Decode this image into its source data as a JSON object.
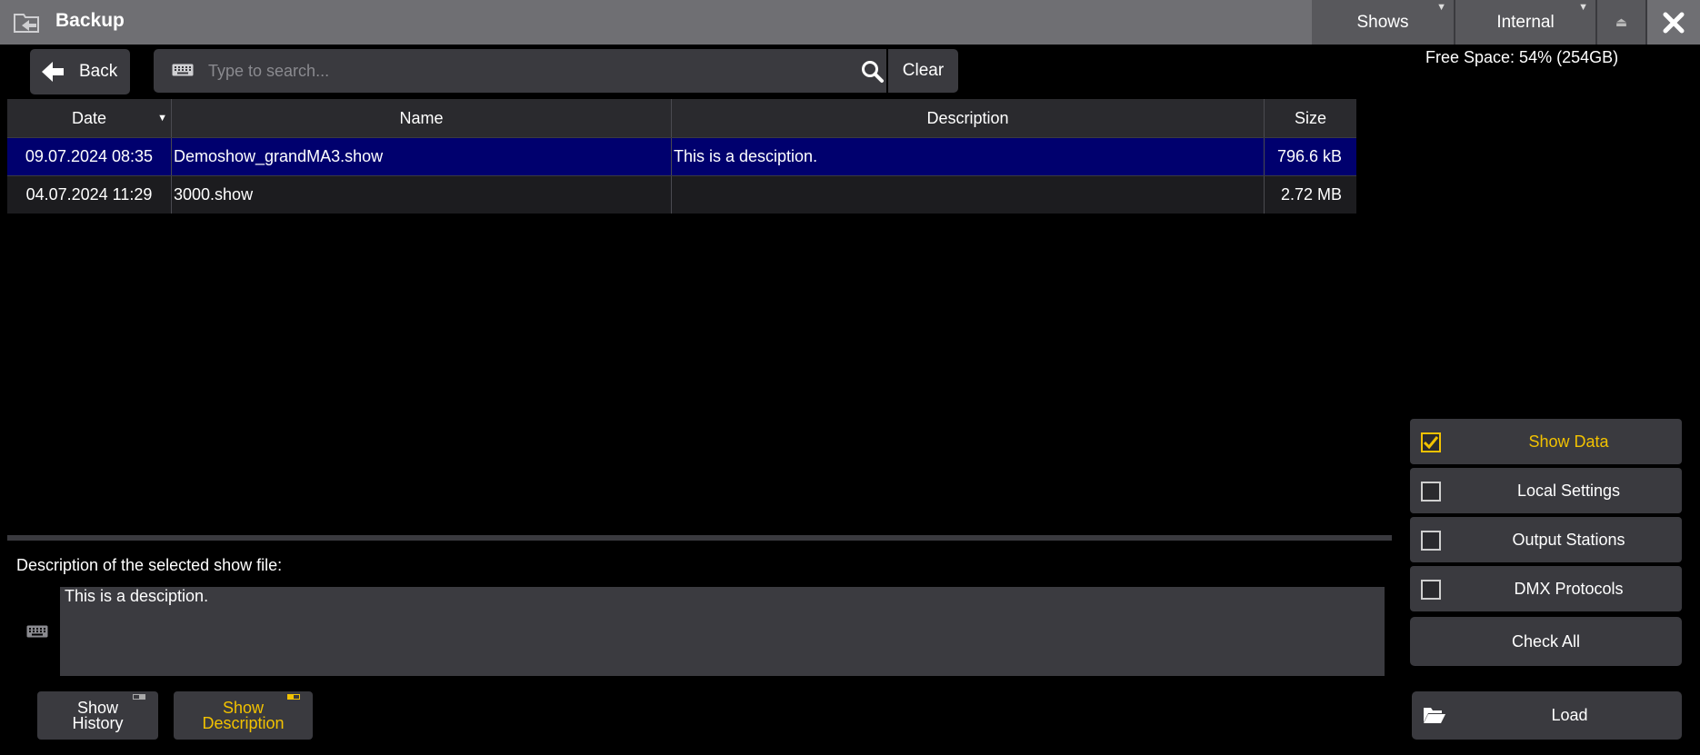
{
  "titlebar": {
    "title": "Backup",
    "shows_label": "Shows",
    "storage_label": "Internal",
    "eject_glyph": "⏏",
    "app_icon": "folder-backup-icon",
    "close_icon": "close-icon"
  },
  "toolbar": {
    "back_label": "Back",
    "search_placeholder": "Type to search...",
    "search_value": "",
    "clear_label": "Clear"
  },
  "free_space": "Free Space: 54% (254GB)",
  "table": {
    "columns": [
      "Date",
      "Name",
      "Description",
      "Size"
    ],
    "rows": [
      {
        "date": "09.07.2024 08:35",
        "name": "Demoshow_grandMA3.show",
        "description": "This is a desciption.",
        "size": "796.6 kB",
        "selected": true
      },
      {
        "date": "04.07.2024 11:29",
        "name": "3000.show",
        "description": "",
        "size": "2.72 MB",
        "selected": false
      }
    ]
  },
  "description": {
    "label": "Description of the selected show file:",
    "text": "This is a desciption."
  },
  "bottom_buttons": {
    "show_history_1": "Show",
    "show_history_2": "History",
    "show_desc_1": "Show",
    "show_desc_2": "Description"
  },
  "options": {
    "show_data": "Show Data",
    "local_settings": "Local Settings",
    "output_stations": "Output Stations",
    "dmx_protocols": "DMX Protocols",
    "check_all": "Check All",
    "load": "Load"
  },
  "colors": {
    "accent": "#f2c200",
    "selected_row": "#00006e",
    "titlebar": "#6f6f73",
    "panel": "#3a3a3f"
  }
}
